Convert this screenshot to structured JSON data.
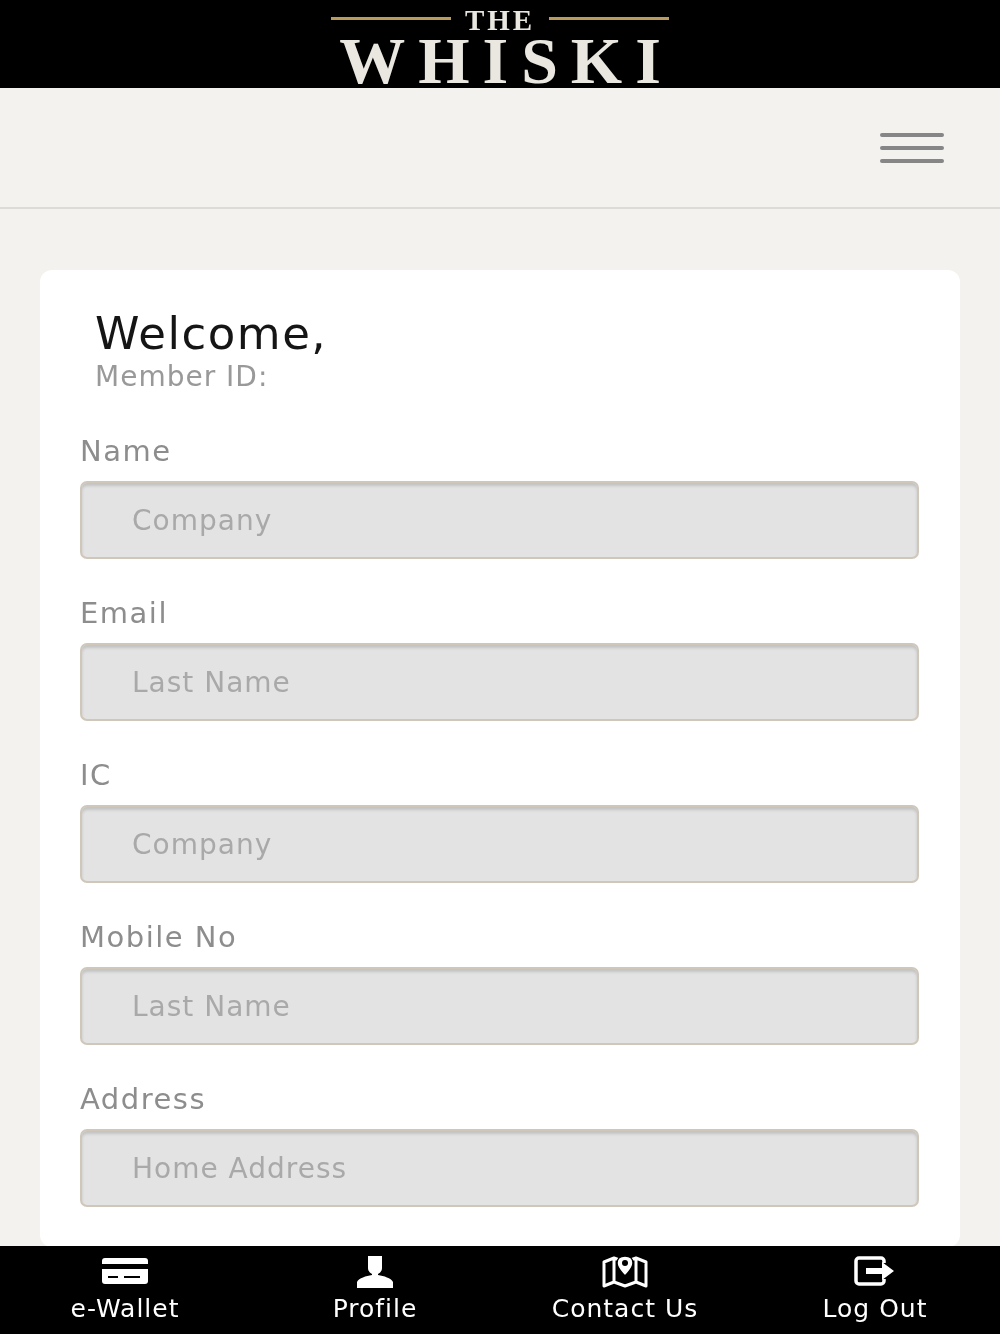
{
  "header": {
    "logo_top": "THE",
    "logo_main": "WHISKI"
  },
  "card": {
    "greeting": "Welcome,",
    "member_id_label": "Member ID:",
    "fields": [
      {
        "label": "Name",
        "placeholder": "Company",
        "disabled": true
      },
      {
        "label": "Email",
        "placeholder": "Last Name",
        "disabled": true
      },
      {
        "label": "IC",
        "placeholder": "Company",
        "disabled": true
      },
      {
        "label": "Mobile No",
        "placeholder": "Last Name",
        "disabled": true
      },
      {
        "label": "Address",
        "placeholder": "Home Address",
        "disabled": true
      }
    ]
  },
  "bottom_nav": [
    {
      "label": "e-Wallet"
    },
    {
      "label": "Profile"
    },
    {
      "label": "Contact Us"
    },
    {
      "label": "Log Out"
    }
  ]
}
